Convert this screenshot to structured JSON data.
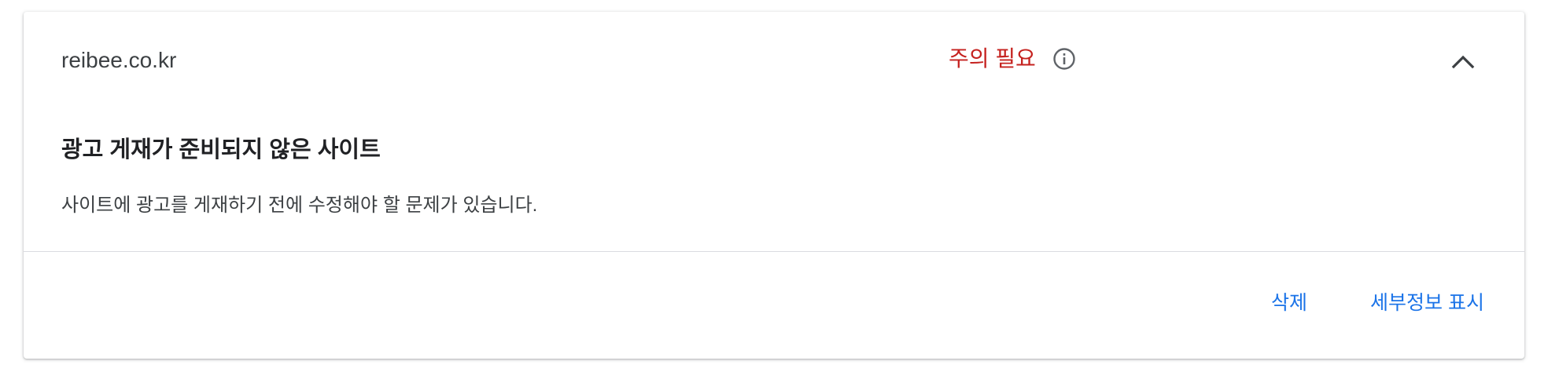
{
  "site": {
    "name": "reibee.co.kr"
  },
  "status": {
    "label": "주의 필요",
    "color": "#c5221f",
    "info_icon": "info-icon",
    "collapse_icon": "chevron-up-icon"
  },
  "body": {
    "heading": "광고 게재가 준비되지 않은 사이트",
    "description": "사이트에 광고를 게재하기 전에 수정해야 할 문제가 있습니다."
  },
  "actions": {
    "delete_label": "삭제",
    "details_label": "세부정보 표시",
    "accent": "#1a73e8"
  }
}
